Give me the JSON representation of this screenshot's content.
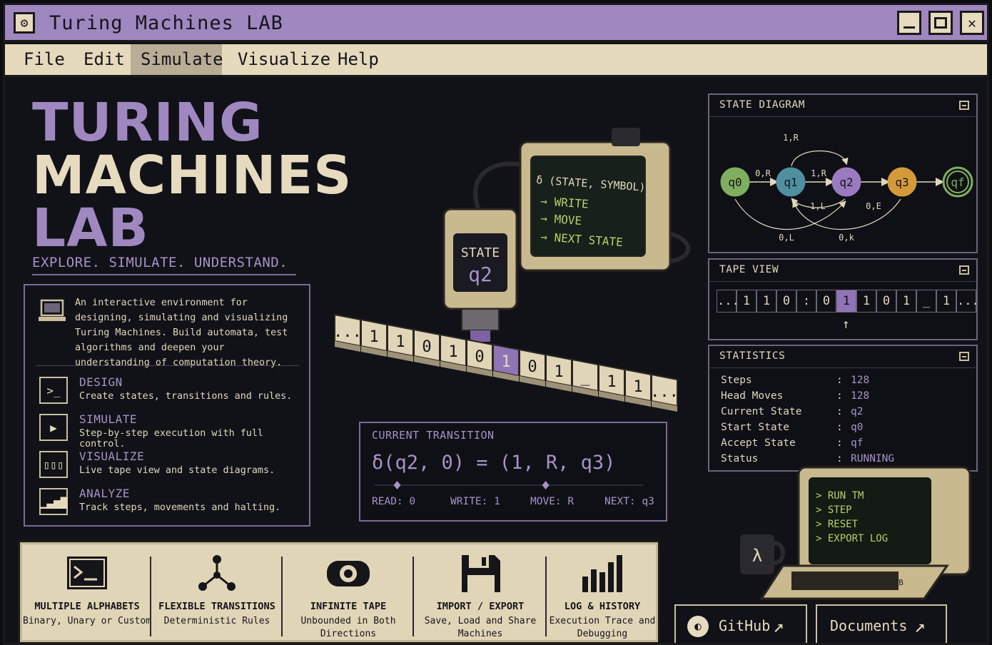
{
  "window": {
    "title": "Turing Machines LAB"
  },
  "menu": {
    "file": "File",
    "edit": "Edit",
    "simulate": "Simulate",
    "visualize": "Visualize",
    "help": "Help"
  },
  "hero": {
    "line1": "TURING",
    "line2": "MACHINES",
    "line3": "LAB",
    "tagline": "EXPLORE. SIMULATE. UNDERSTAND.",
    "description": "An interactive environment for designing, simulating and visualizing Turing Machines. Build automata, test algorithms and deepen your understanding of computation theory."
  },
  "features": [
    {
      "title": "DESIGN",
      "desc": "Create states, transitions and rules."
    },
    {
      "title": "SIMULATE",
      "desc": "Step-by-step execution with full control."
    },
    {
      "title": "VISUALIZE",
      "desc": "Live tape view and state diagrams."
    },
    {
      "title": "ANALYZE",
      "desc": "Track steps, movements and halting."
    }
  ],
  "machine": {
    "state_label": "STATE",
    "state_value": "q2",
    "screen_title": "δ (STATE, SYMBOL)",
    "screen_lines": [
      "→ WRITE",
      "→ MOVE",
      "→ NEXT STATE"
    ],
    "tape": [
      "...",
      "1",
      "1",
      "0",
      "1",
      "0",
      "1",
      "0",
      "1",
      "_",
      "1",
      "1",
      "..."
    ]
  },
  "transition": {
    "title": "CURRENT TRANSITION",
    "formula": "δ(q2, 0) = (1, R, q3)",
    "read": "READ: 0",
    "write": "WRITE: 1",
    "move": "MOVE: R",
    "next": "NEXT: q3"
  },
  "state_diagram": {
    "title": "STATE DIAGRAM",
    "states": [
      "q0",
      "q1",
      "q2",
      "q3",
      "qf"
    ],
    "labels": {
      "top": "1,R",
      "q0q1": "0,R",
      "q1q2": "1,R",
      "back": "1,L",
      "q2q3": "0,E",
      "bottom1": "0,L",
      "bottom2": "0,k"
    },
    "colors": {
      "q0": "#7fae5e",
      "q1": "#4f8fa0",
      "q2": "#9a7bc0",
      "q3": "#d49a3a",
      "qf": "#7fae5e"
    }
  },
  "tape_view": {
    "title": "TAPE VIEW",
    "cells": [
      "...",
      "1",
      "1",
      "0",
      ":",
      "0",
      "1",
      "1",
      "0",
      "1",
      "_",
      "1",
      "..."
    ],
    "head_index": 6
  },
  "statistics": {
    "title": "STATISTICS",
    "rows": [
      {
        "label": "Steps",
        "value": "128"
      },
      {
        "label": "Head Moves",
        "value": "128"
      },
      {
        "label": "Current State",
        "value": "q2"
      },
      {
        "label": "Start State",
        "value": "q0"
      },
      {
        "label": "Accept State",
        "value": "qf"
      },
      {
        "label": "Status",
        "value": "RUNNING"
      }
    ]
  },
  "terminal": {
    "lines": [
      "> RUN TM",
      "> STEP",
      "> RESET",
      "> EXPORT LOG"
    ],
    "mug_symbol": "λ",
    "sticker": "TM LAB"
  },
  "feature_bar": [
    {
      "icon": "terminal-icon",
      "title": "MULTIPLE ALPHABETS",
      "sub": "Binary, Unary or Custom"
    },
    {
      "icon": "graph-icon",
      "title": "FLEXIBLE TRANSITIONS",
      "sub": "Deterministic Rules"
    },
    {
      "icon": "tape-reel-icon",
      "title": "INFINITE TAPE",
      "sub": "Unbounded in Both Directions"
    },
    {
      "icon": "floppy-icon",
      "title": "IMPORT / EXPORT",
      "sub": "Save, Load and Share Machines"
    },
    {
      "icon": "bar-chart-icon",
      "title": "LOG & HISTORY",
      "sub": "Execution Trace and Debugging"
    }
  ],
  "links": {
    "github": "GitHub",
    "docs": "Documents"
  }
}
